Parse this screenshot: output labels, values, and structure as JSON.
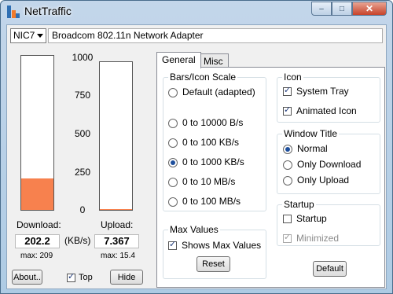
{
  "window": {
    "title": "NetTraffic",
    "minimize": "‒",
    "maximize": "□",
    "close": "✕"
  },
  "adapter": {
    "nic": "NIC7",
    "name": "Broadcom 802.11n Network Adapter"
  },
  "meters": {
    "scale": [
      "1000",
      "750",
      "500",
      "250",
      "0"
    ],
    "download": {
      "label": "Download:",
      "value": "202.2",
      "max": "max: 209",
      "fill_fraction": 0.2022
    },
    "upload": {
      "label": "Upload:",
      "value": "7.367",
      "max": "max: 15.4",
      "fill_fraction": 0.0074
    },
    "unit": "(KB/s)"
  },
  "bottom": {
    "about": "About..",
    "top_label": "Top",
    "top_checked": true,
    "hide": "Hide"
  },
  "tabs": [
    {
      "label": "General",
      "active": true
    },
    {
      "label": "Misc",
      "active": false
    }
  ],
  "scale_group": {
    "title": "Bars/Icon Scale",
    "options": [
      {
        "label": "Default (adapted)",
        "checked": false
      },
      {
        "label": "0 to 10000 B/s",
        "checked": false
      },
      {
        "label": "0 to 100 KB/s",
        "checked": false
      },
      {
        "label": "0 to 1000 KB/s",
        "checked": true
      },
      {
        "label": "0 to 10 MB/s",
        "checked": false
      },
      {
        "label": "0 to 100 MB/s",
        "checked": false
      }
    ]
  },
  "max_group": {
    "title": "Max Values",
    "show_label": "Shows Max Values",
    "show_checked": true,
    "reset": "Reset"
  },
  "icon_group": {
    "title": "Icon",
    "system_tray": {
      "label": "System Tray",
      "checked": true
    },
    "animated": {
      "label": "Animated Icon",
      "checked": true
    }
  },
  "title_group": {
    "title": "Window Title",
    "options": [
      {
        "label": "Normal",
        "checked": true
      },
      {
        "label": "Only Download",
        "checked": false
      },
      {
        "label": "Only Upload",
        "checked": false
      }
    ]
  },
  "startup_group": {
    "title": "Startup",
    "startup": {
      "label": "Startup",
      "checked": false
    },
    "minimized": {
      "label": "Minimized",
      "checked": true,
      "disabled": true
    }
  },
  "default_button": "Default"
}
